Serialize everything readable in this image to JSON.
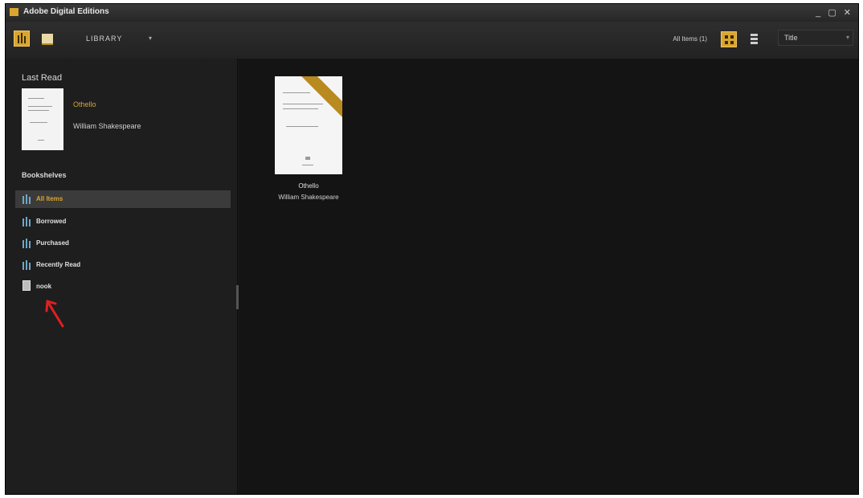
{
  "window": {
    "title": "Adobe Digital Editions",
    "controls": "_ ▢ ✕"
  },
  "toolbar": {
    "library_label": "LIBRARY",
    "dropdown_arrow": "▾",
    "items_count": "All Items (1)",
    "sort_value": "Title",
    "sort_arrow": "▾"
  },
  "sidebar": {
    "last_read_heading": "Last Read",
    "last_read": {
      "title": "Othello",
      "author": "William Shakespeare"
    },
    "bookshelves_heading": "Bookshelves",
    "shelves": [
      {
        "label": "All Items",
        "icon": "bookshelf-icon",
        "selected": true
      },
      {
        "label": "Borrowed",
        "icon": "bookshelf-icon"
      },
      {
        "label": "Purchased",
        "icon": "bookshelf-icon"
      },
      {
        "label": "Recently Read",
        "icon": "bookshelf-icon"
      },
      {
        "label": "nook",
        "icon": "device-icon"
      }
    ]
  },
  "books": [
    {
      "title": "Othello",
      "author": "William Shakespeare"
    }
  ],
  "colors": {
    "accent": "#d9a531",
    "shelf_icon": "#6fa7c7",
    "annotation": "#e02020"
  }
}
